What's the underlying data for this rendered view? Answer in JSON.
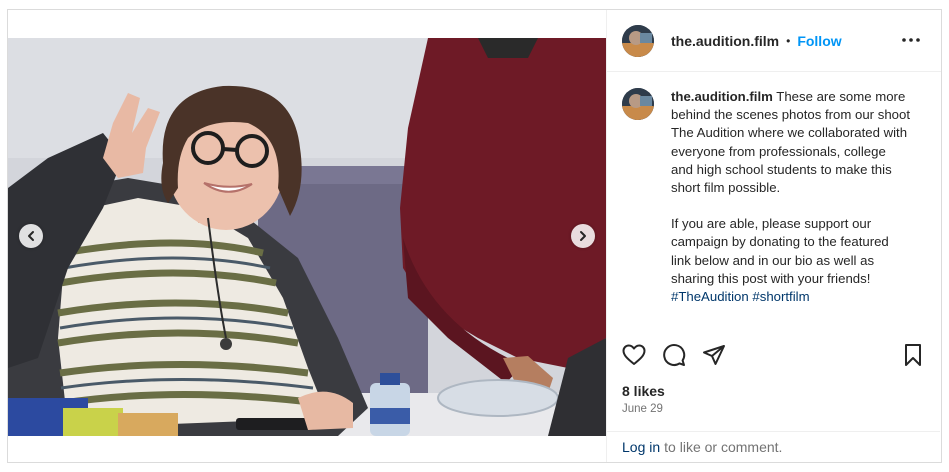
{
  "post": {
    "username": "the.audition.film",
    "separator": "•",
    "follow_label": "Follow",
    "more_icon": "more-horizontal-icon"
  },
  "caption": {
    "username": "the.audition.film",
    "paragraph1": "These are some more behind the scenes photos from our shoot The Audition where we collaborated with everyone from professionals, college and high school students to make this short film possible.",
    "paragraph2": "If you are able, please support our campaign by donating to the featured link below and in our bio as well as sharing this post with your friends!",
    "hashtags": [
      "#TheAudition",
      "#shortfilm"
    ]
  },
  "actions": {
    "icons": [
      "heart-icon",
      "comment-icon",
      "share-icon",
      "bookmark-icon"
    ]
  },
  "likes_text": "8 likes",
  "date_text": "June 29",
  "footer": {
    "login_label": "Log in",
    "rest_text": "to like or comment."
  },
  "colors": {
    "follow": "#0095f6",
    "link": "#00376b",
    "muted": "#737373",
    "border": "#dbdbdb"
  }
}
